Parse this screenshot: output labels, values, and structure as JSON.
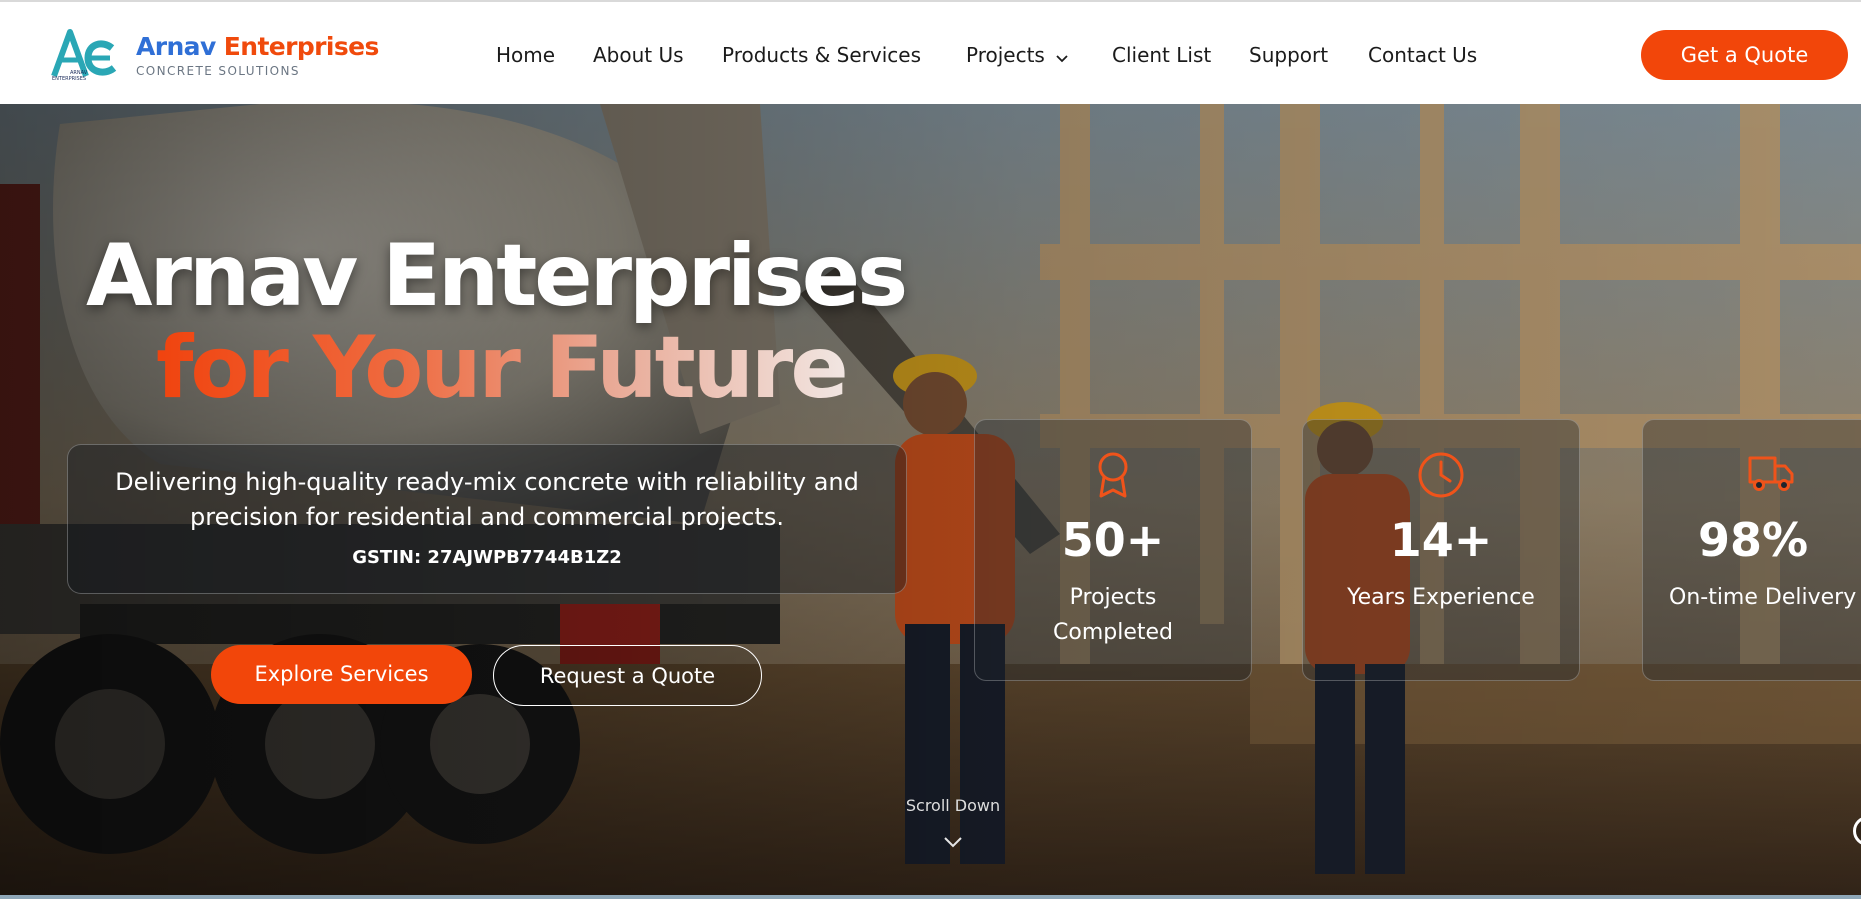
{
  "brand": {
    "name_part1": "Arnav",
    "name_part2": "Enterprises",
    "tagline": "CONCRETE SOLUTIONS",
    "logo_initials": "AE",
    "logo_caption_line1": "ARNAV",
    "logo_caption_line2": "ENTERPRISES",
    "logo_icon": "ae-monogram-icon"
  },
  "nav": {
    "items": [
      {
        "label": "Home"
      },
      {
        "label": "About Us"
      },
      {
        "label": "Products & Services"
      },
      {
        "label": "Projects",
        "icon": "chevron-down-icon"
      },
      {
        "label": "Client List"
      },
      {
        "label": "Support"
      },
      {
        "label": "Contact Us"
      }
    ],
    "cta_label": "Get a Quote"
  },
  "hero": {
    "headline_line1": "Arnav Enterprises",
    "headline_line2": "for Your Future",
    "description": "Delivering high-quality ready-mix concrete with reliability and precision for residential and commercial projects.",
    "gstin": "GSTIN: 27AJWPB7744B1Z2",
    "primary_button": "Explore Services",
    "secondary_button": "Request a Quote",
    "scroll_label": "Scroll Down",
    "background": "construction-site-photo"
  },
  "stats": [
    {
      "value": "50+",
      "label_line1": "Projects",
      "label_line2": "Completed",
      "icon": "award-ribbon-icon"
    },
    {
      "value": "14+",
      "label_line1": "Years Experience",
      "label_line2": "",
      "icon": "clock-icon"
    },
    {
      "value": "98%",
      "label_line1": "On-time Delivery",
      "label_line2": "",
      "icon": "truck-icon"
    }
  ],
  "colors": {
    "accent": "#f2460a",
    "brand_blue": "#2f6fd6",
    "brand_orange": "#f04a0c",
    "nav_text": "#1b1b1b",
    "tagline_gray": "#6b7683"
  }
}
